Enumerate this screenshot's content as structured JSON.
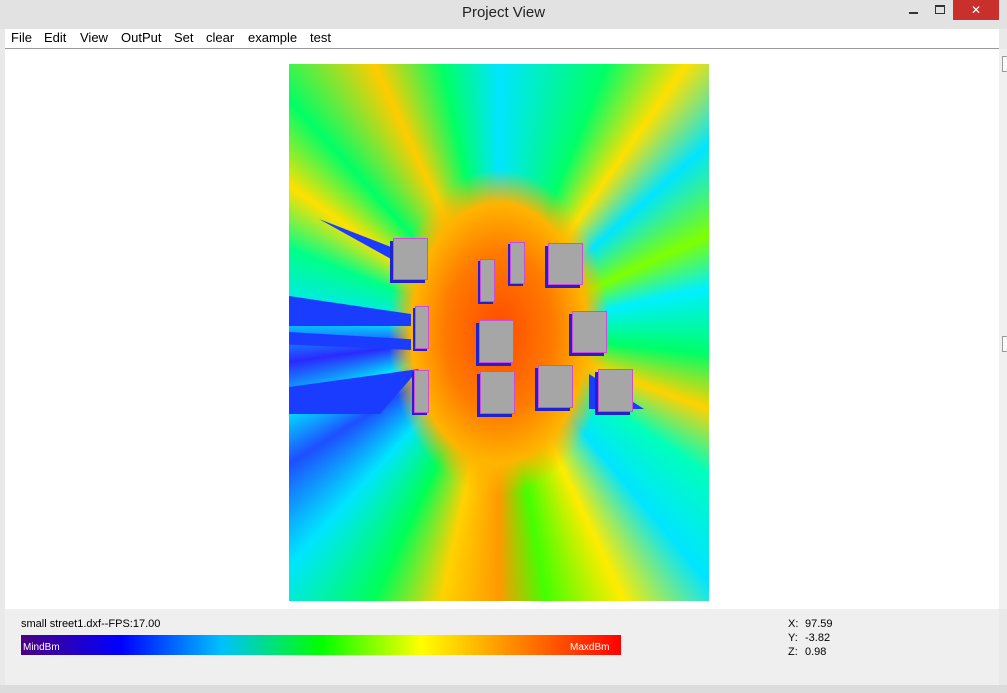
{
  "window": {
    "title": "Project View",
    "close_glyph": "✕"
  },
  "menu": {
    "items": [
      "File",
      "Edit",
      "View",
      "OutPut",
      "Set",
      "clear",
      "example",
      "test"
    ]
  },
  "icons": {
    "minimize": "minimize-icon",
    "maximize": "maximize-icon",
    "close": "close-icon"
  },
  "status": {
    "file_info": "small street1.dxf--FPS:17.00",
    "min_label": "MindBm",
    "max_label": "MaxdBm",
    "colorbar_colors": [
      "#4b0082",
      "#0000ff",
      "#00c0ff",
      "#00ff00",
      "#ffff00",
      "#ff8000",
      "#ff0000"
    ]
  },
  "coords": {
    "x_label": "X:",
    "x_value": "97.59",
    "y_label": "Y:",
    "y_value": "-3.82",
    "z_label": "Z:",
    "z_value": "0.98"
  }
}
